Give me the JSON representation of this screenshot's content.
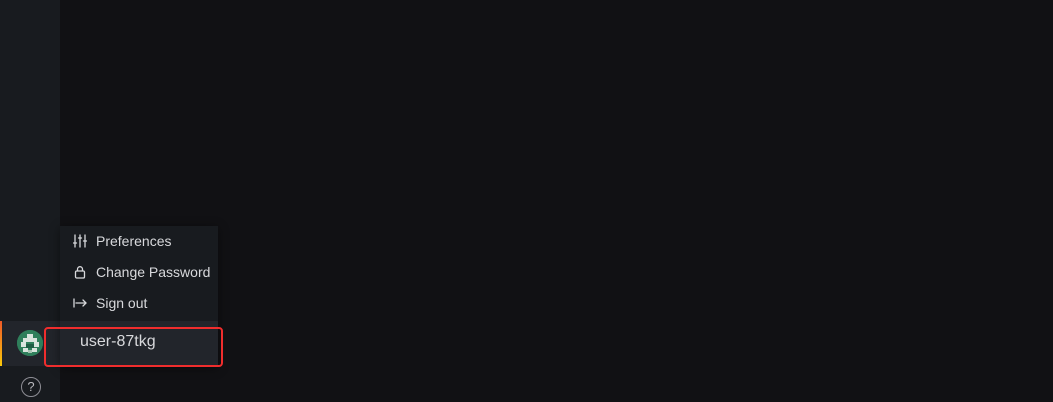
{
  "sidebar": {
    "help_label": "?",
    "help_icon": "question-circle-icon",
    "avatar_icon": "identicon-avatar"
  },
  "profile_menu": {
    "items": [
      {
        "label": "Preferences",
        "icon": "sliders-icon"
      },
      {
        "label": "Change Password",
        "icon": "lock-icon"
      },
      {
        "label": "Sign out",
        "icon": "sign-out-icon"
      }
    ],
    "username": "user-87tkg"
  },
  "colors": {
    "background": "#111114",
    "sidebar": "#181b1f",
    "active_row": "#22252b",
    "text": "#d8d9dc",
    "annotation": "#f02d2d",
    "accent_start": "#f05a28",
    "accent_end": "#fbca0a",
    "avatar": "#2f7f5b"
  }
}
